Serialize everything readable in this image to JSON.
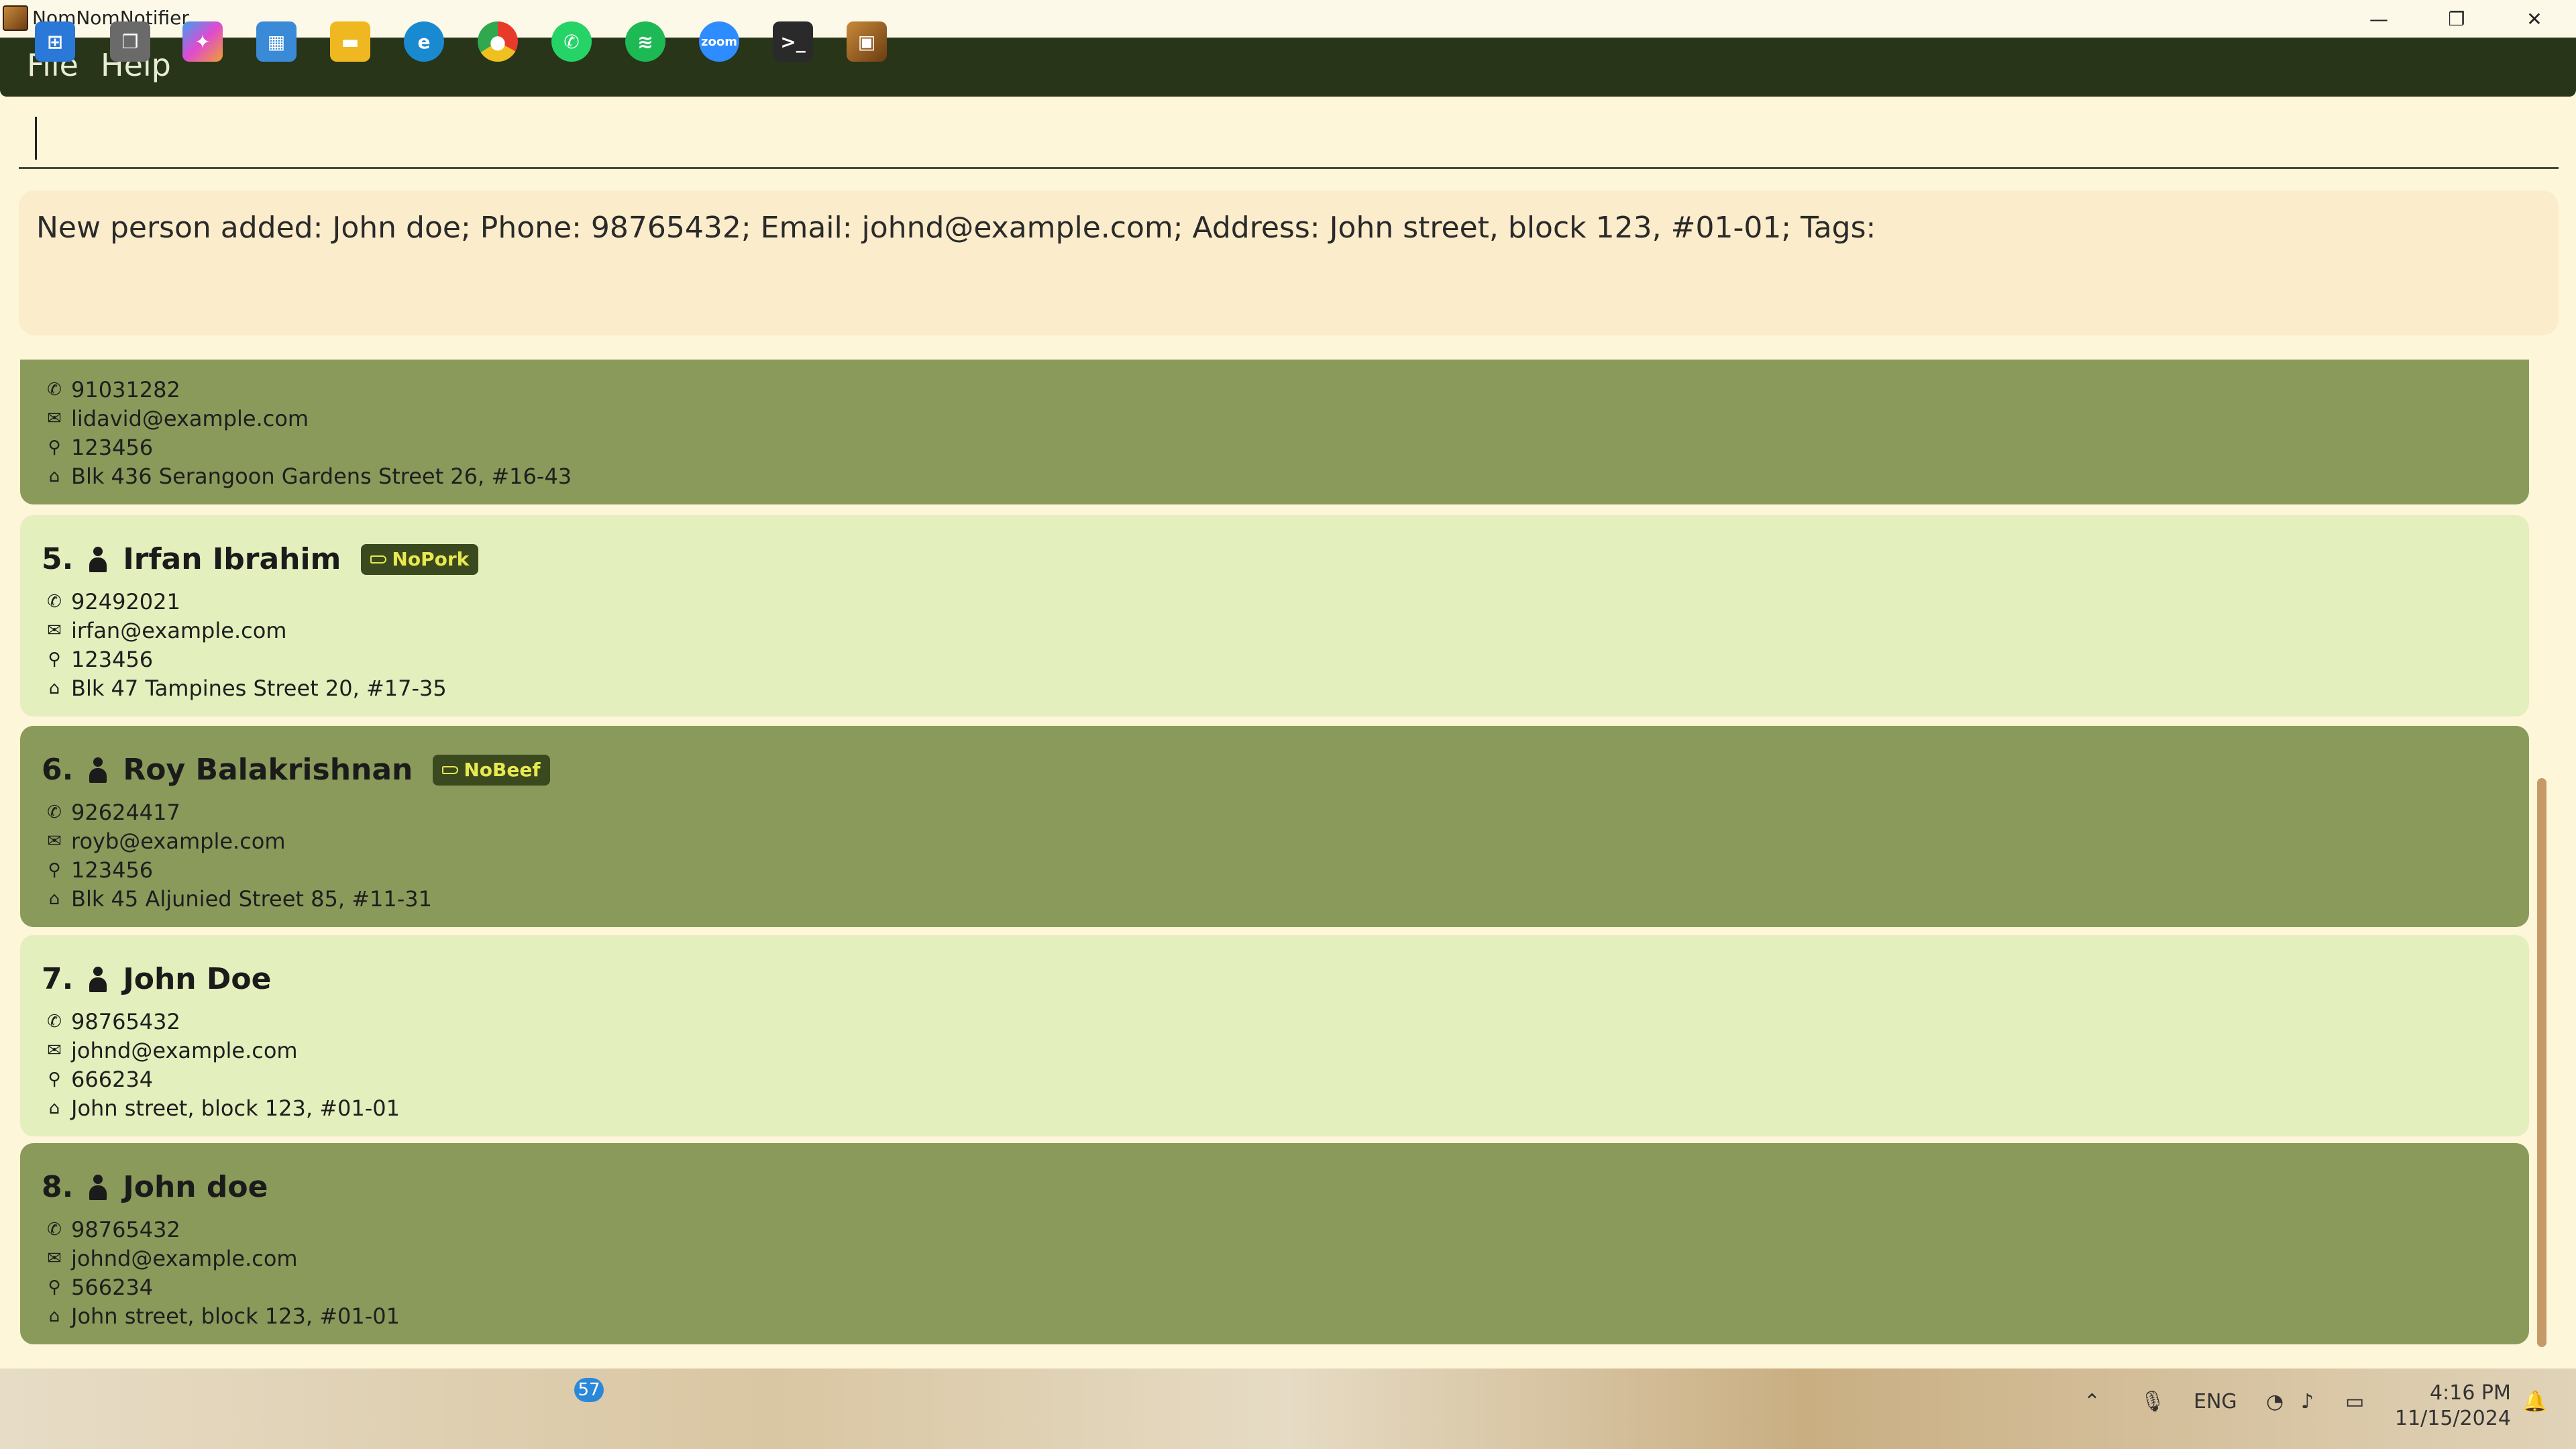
{
  "window": {
    "title": "NomNomNotifier",
    "controls": {
      "minimize": "—",
      "restore": "❐",
      "close": "✕"
    }
  },
  "menu": {
    "file": "File",
    "help": "Help"
  },
  "command": {
    "value": ""
  },
  "result": {
    "text": "New person added: John doe; Phone: 98765432; Email: johnd@example.com; Address: John street, block 123, #01-01; Tags:"
  },
  "persons": [
    {
      "index": "",
      "name": "",
      "tag": "",
      "phone": "91031282",
      "email": "lidavid@example.com",
      "postal": "123456",
      "address": "Blk 436 Serangoon Gardens Street 26, #16-43"
    },
    {
      "index": "5.",
      "name": "Irfan Ibrahim",
      "tag": "NoPork",
      "phone": "92492021",
      "email": "irfan@example.com",
      "postal": "123456",
      "address": "Blk 47 Tampines Street 20, #17-35"
    },
    {
      "index": "6.",
      "name": "Roy Balakrishnan",
      "tag": "NoBeef",
      "phone": "92624417",
      "email": "royb@example.com",
      "postal": "123456",
      "address": "Blk 45 Aljunied Street 85, #11-31"
    },
    {
      "index": "7.",
      "name": "John Doe",
      "tag": "",
      "phone": "98765432",
      "email": "johnd@example.com",
      "postal": "666234",
      "address": "John street, block 123, #01-01"
    },
    {
      "index": "8.",
      "name": "John doe",
      "tag": "",
      "phone": "98765432",
      "email": "johnd@example.com",
      "postal": "566234",
      "address": "John street, block 123, #01-01"
    }
  ],
  "icons": {
    "phone": "phone-icon",
    "email": "email-icon",
    "postal": "pin-icon",
    "address": "home-icon",
    "person": "person-icon",
    "tag": "tag-icon"
  },
  "colors": {
    "menubar": "#283519",
    "card_dark": "#8a9a5b",
    "card_light": "#e3efbc",
    "tag_bg": "#3a4a1e",
    "tag_text": "#e8e850"
  },
  "taskbar": {
    "whatsapp_badge": "57",
    "tray_lang": "ENG",
    "time": "4:16 PM",
    "date": "11/15/2024"
  }
}
